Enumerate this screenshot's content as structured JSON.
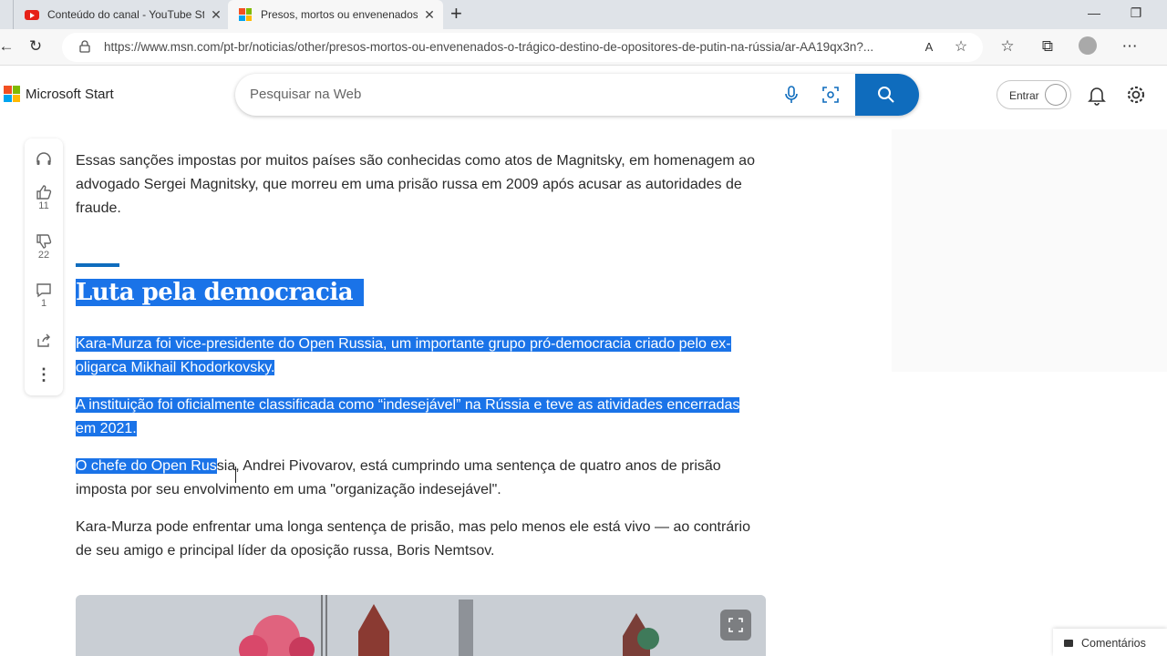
{
  "browser": {
    "tabs": [
      {
        "title": "Conteúdo do canal - YouTube Studio"
      },
      {
        "title": "Presos, mortos ou envenenados: o trágico destino"
      }
    ],
    "url": "https://www.msn.com/pt-br/noticias/other/presos-mortos-ou-envenenados-o-trágico-destino-de-opositores-de-putin-na-rússia/ar-AA19qx3n?..."
  },
  "header": {
    "brand": "Microsoft Start",
    "search_placeholder": "Pesquisar na Web",
    "signin_label": "Entrar"
  },
  "rail": {
    "likes": "11",
    "dislikes": "22",
    "comments": "1"
  },
  "article": {
    "p1": "Essas sanções impostas por muitos países são conhecidas como atos de Magnitsky, em homenagem ao advogado Sergei Magnitsky, que morreu em uma prisão russa em 2009 após acusar as autoridades de fraude.",
    "heading": "Luta pela democracia",
    "p2_l1": "Kara-Murza foi vice-presidente do Open Russia, um importante grupo pró-democracia criado pelo ex-",
    "p2_l2": "oligarca Mikhail Khodorkovsky.",
    "p3_l1": "A instituição foi oficialmente classificada como “indesejável” na Rússia e teve as atividades encerradas",
    "p3_l2": "em 2021.",
    "p4_sel": "O chefe do Open Rus",
    "p4_rest": "sia, Andrei Pivovarov, está cumprindo uma sentença de quatro anos de prisão",
    "p4_l2": "imposta por seu envolvimento em uma \"organização indesejável\".",
    "p5": "Kara-Murza pode enfrentar uma longa sentença de prisão, mas pelo menos ele está vivo — ao contrário de seu amigo e principal líder da oposição russa, Boris Nemtsov."
  },
  "footer": {
    "comments_label": "Comentários"
  },
  "colors": {
    "accent": "#0f6cbd",
    "selection": "#1a73e8"
  }
}
